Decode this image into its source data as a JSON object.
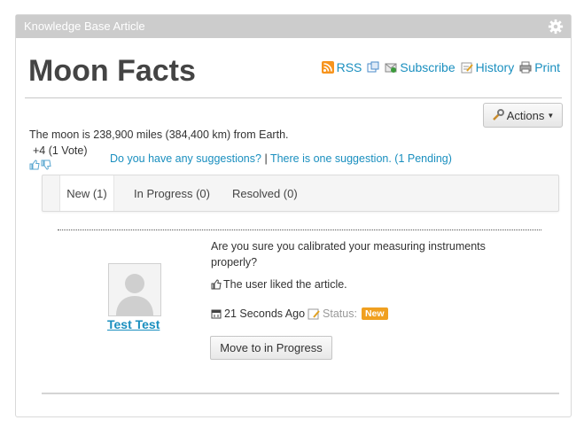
{
  "header": {
    "title": "Knowledge Base Article"
  },
  "article": {
    "title": "Moon Facts",
    "intro": "The moon is 238,900 miles (384,400 km) from Earth.",
    "votes": "+4 (1 Vote)"
  },
  "toplinks": {
    "rss": "RSS",
    "subscribe": "Subscribe",
    "history": "History",
    "print": "Print"
  },
  "actions": {
    "label": "Actions"
  },
  "suggestions": {
    "ask": "Do you have any suggestions?",
    "separator": "|",
    "pending": "There is one suggestion. (1 Pending)"
  },
  "tabs": [
    {
      "label": "New (1)"
    },
    {
      "label": "In Progress (0)"
    },
    {
      "label": "Resolved (0)"
    }
  ],
  "suggestion_item": {
    "user": "Test Test",
    "text": "Are you sure you calibrated your measuring instruments properly?",
    "liked": "The user liked the article.",
    "time": "21 Seconds Ago",
    "status_label": "Status:",
    "status": "New",
    "button": "Move to in Progress"
  },
  "colors": {
    "link": "#1a8fbf",
    "badge": "#f0a020",
    "header": "#cccccc"
  }
}
